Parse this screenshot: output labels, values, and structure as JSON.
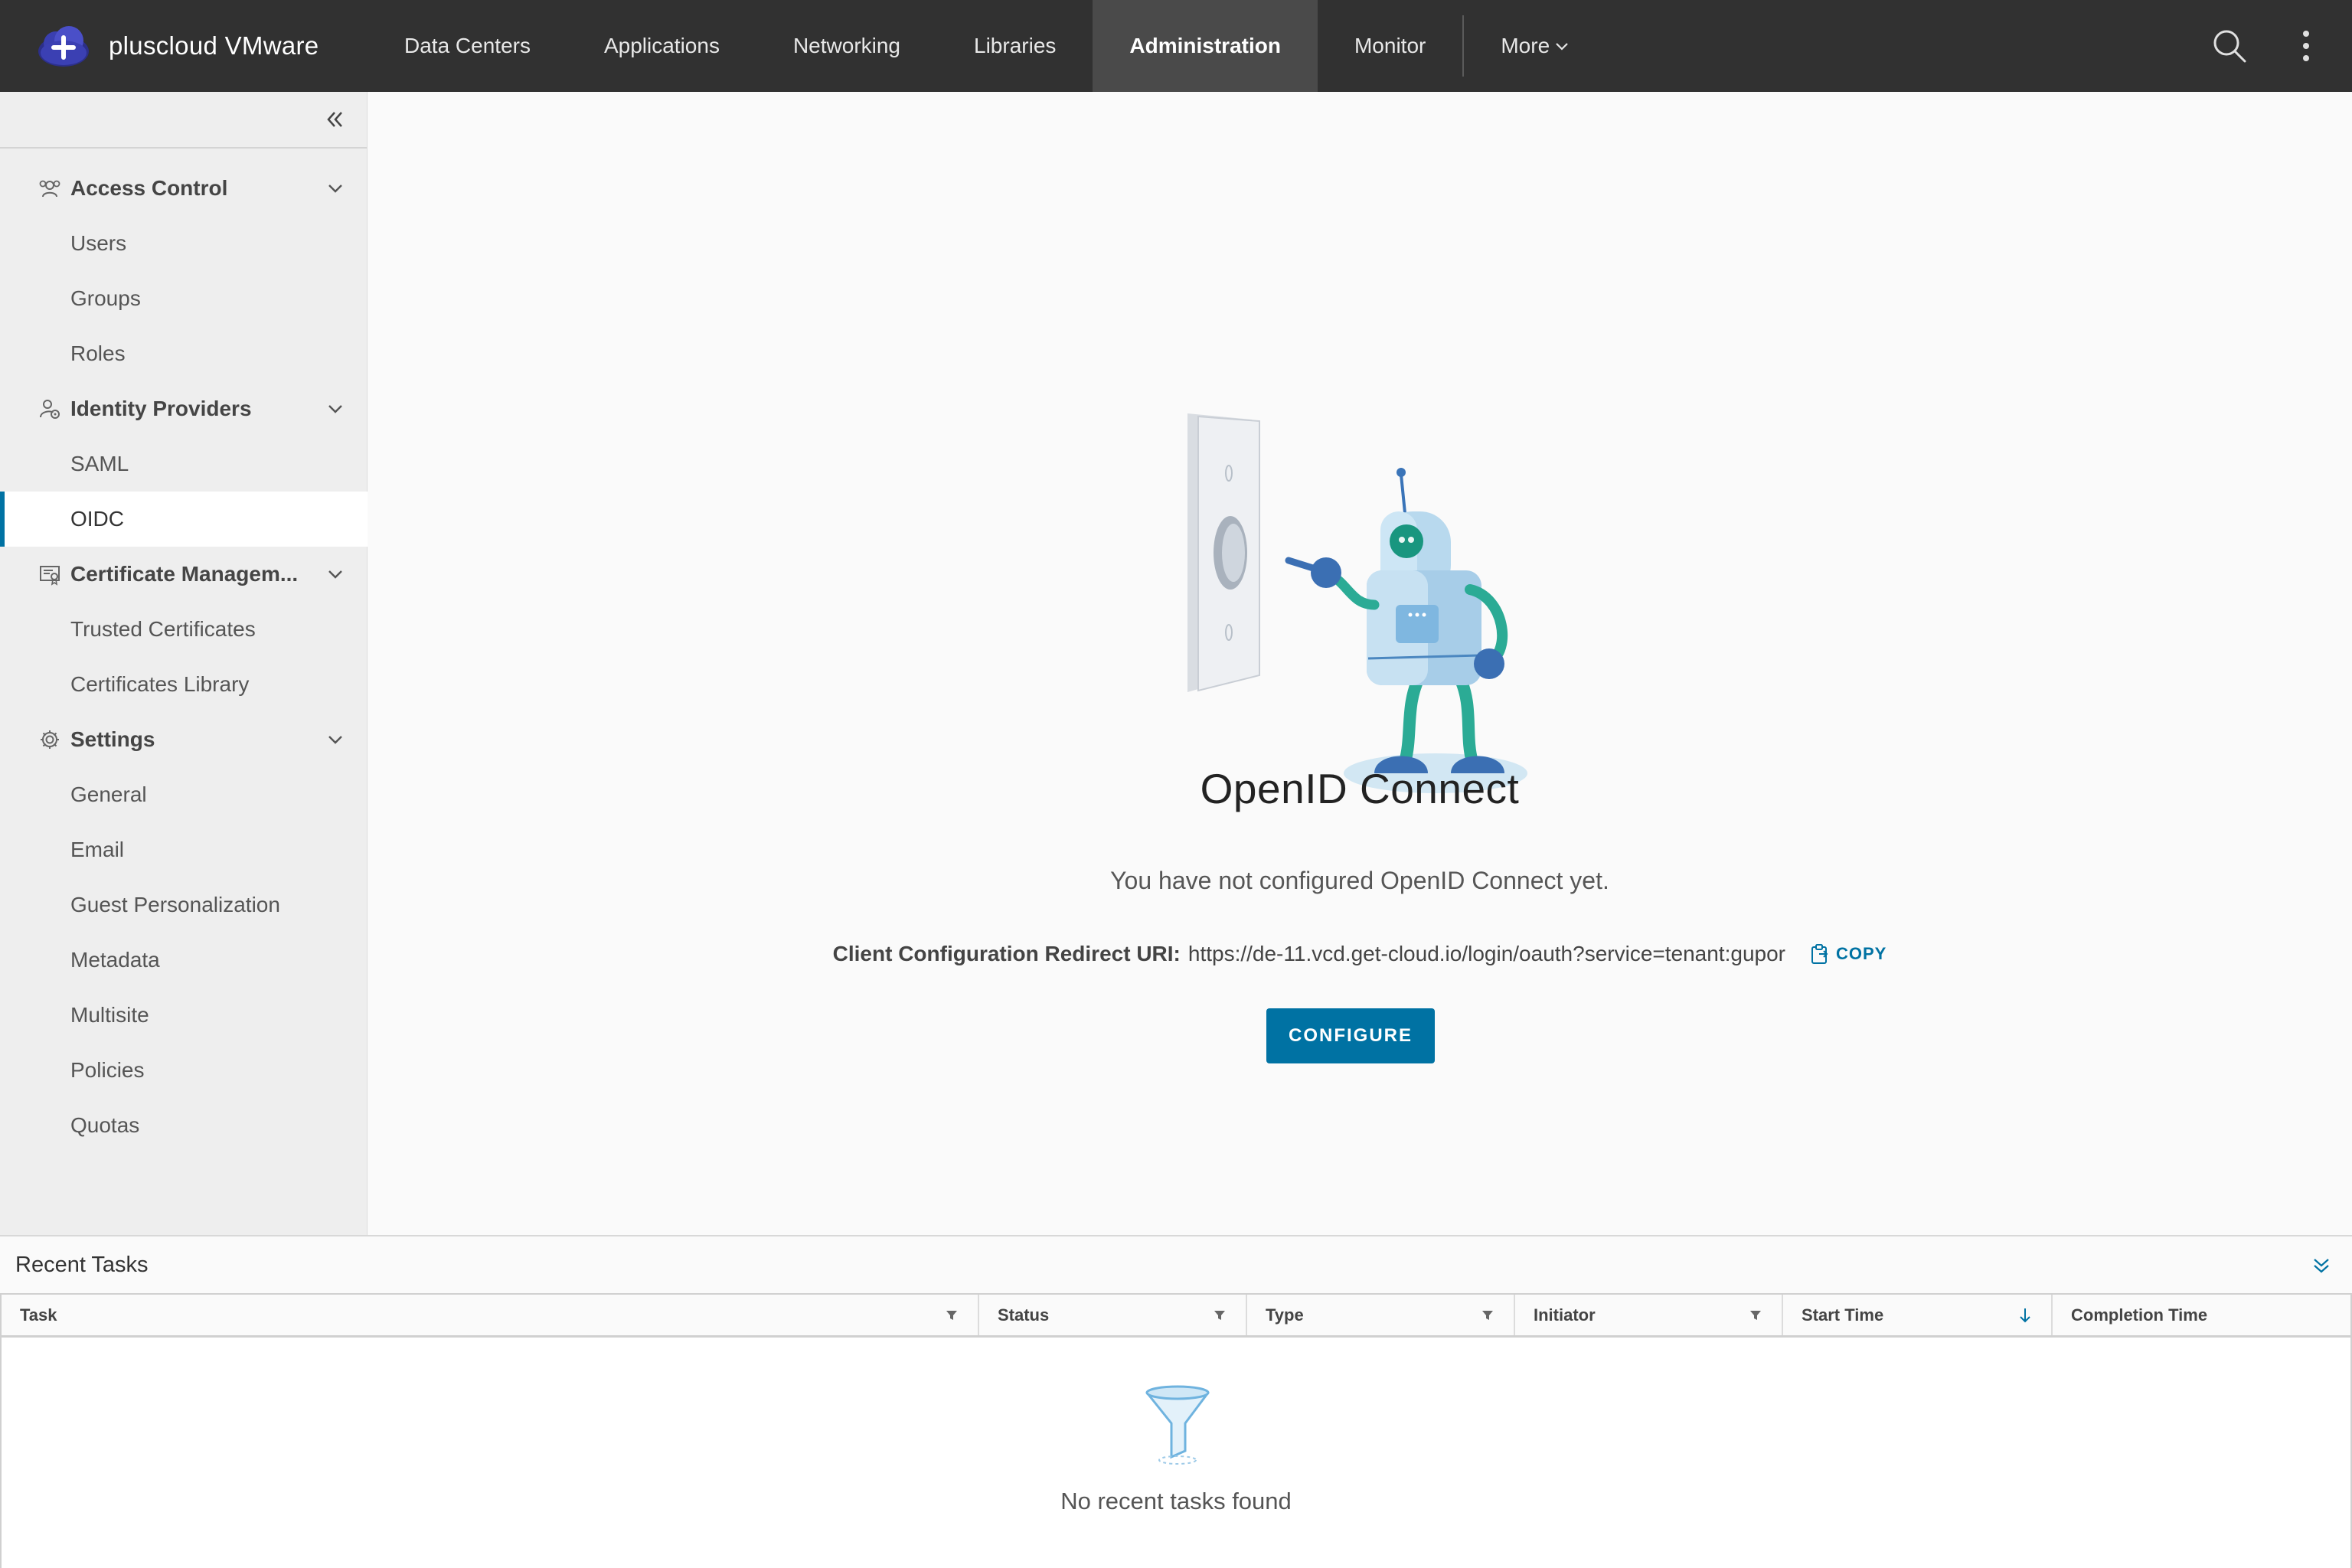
{
  "header": {
    "brand": "pluscloud VMware",
    "nav": [
      "Data Centers",
      "Applications",
      "Networking",
      "Libraries",
      "Administration",
      "Monitor"
    ],
    "active": "Administration",
    "more_label": "More"
  },
  "sidebar": {
    "groups": [
      {
        "label": "Access Control",
        "icon": "users-icon",
        "items": [
          "Users",
          "Groups",
          "Roles"
        ]
      },
      {
        "label": "Identity Providers",
        "icon": "identity-icon",
        "items": [
          "SAML",
          "OIDC"
        ]
      },
      {
        "label": "Certificate Managem...",
        "icon": "certificate-icon",
        "items": [
          "Trusted Certificates",
          "Certificates Library"
        ]
      },
      {
        "label": "Settings",
        "icon": "gear-icon",
        "items": [
          "General",
          "Email",
          "Guest Personalization",
          "Metadata",
          "Multisite",
          "Policies",
          "Quotas"
        ]
      }
    ],
    "active_item": "OIDC"
  },
  "main": {
    "title": "OpenID Connect",
    "description": "You have not configured OpenID Connect yet.",
    "uri_label": "Client Configuration Redirect URI:",
    "uri_value": "https://de-11.vcd.get-cloud.io/login/oauth?service=tenant:gupor",
    "copy_label": "COPY",
    "configure_label": "CONFIGURE"
  },
  "tasks": {
    "title": "Recent Tasks",
    "columns": [
      "Task",
      "Status",
      "Type",
      "Initiator",
      "Start Time",
      "Completion Time"
    ],
    "empty_text": "No recent tasks found"
  },
  "colors": {
    "header_bg": "#313131",
    "accent": "#0072a3",
    "sidebar_bg": "#eeeeee"
  }
}
